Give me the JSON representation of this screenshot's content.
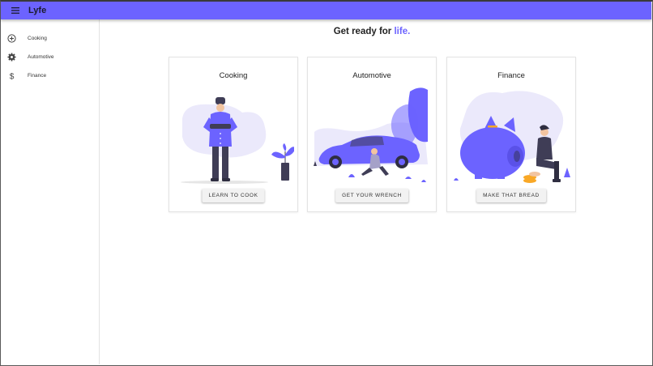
{
  "app": {
    "title": "Lyfe",
    "accent_color": "#6c63ff"
  },
  "header": {
    "menu_icon": "hamburger-menu-icon"
  },
  "sidebar": {
    "items": [
      {
        "label": "Cooking",
        "icon": "add-circle-icon"
      },
      {
        "label": "Automotive",
        "icon": "gear-icon"
      },
      {
        "label": "Finance",
        "icon": "dollar-icon"
      }
    ]
  },
  "main": {
    "heading_prefix": "Get ready for ",
    "heading_accent": "life.",
    "cards": [
      {
        "title": "Cooking",
        "button_label": "LEARN TO COOK",
        "illustration": "chef-illustration"
      },
      {
        "title": "Automotive",
        "button_label": "GET YOUR WRENCH",
        "illustration": "car-mechanic-illustration"
      },
      {
        "title": "Finance",
        "button_label": "MAKE THAT BREAD",
        "illustration": "piggy-bank-illustration"
      }
    ]
  }
}
